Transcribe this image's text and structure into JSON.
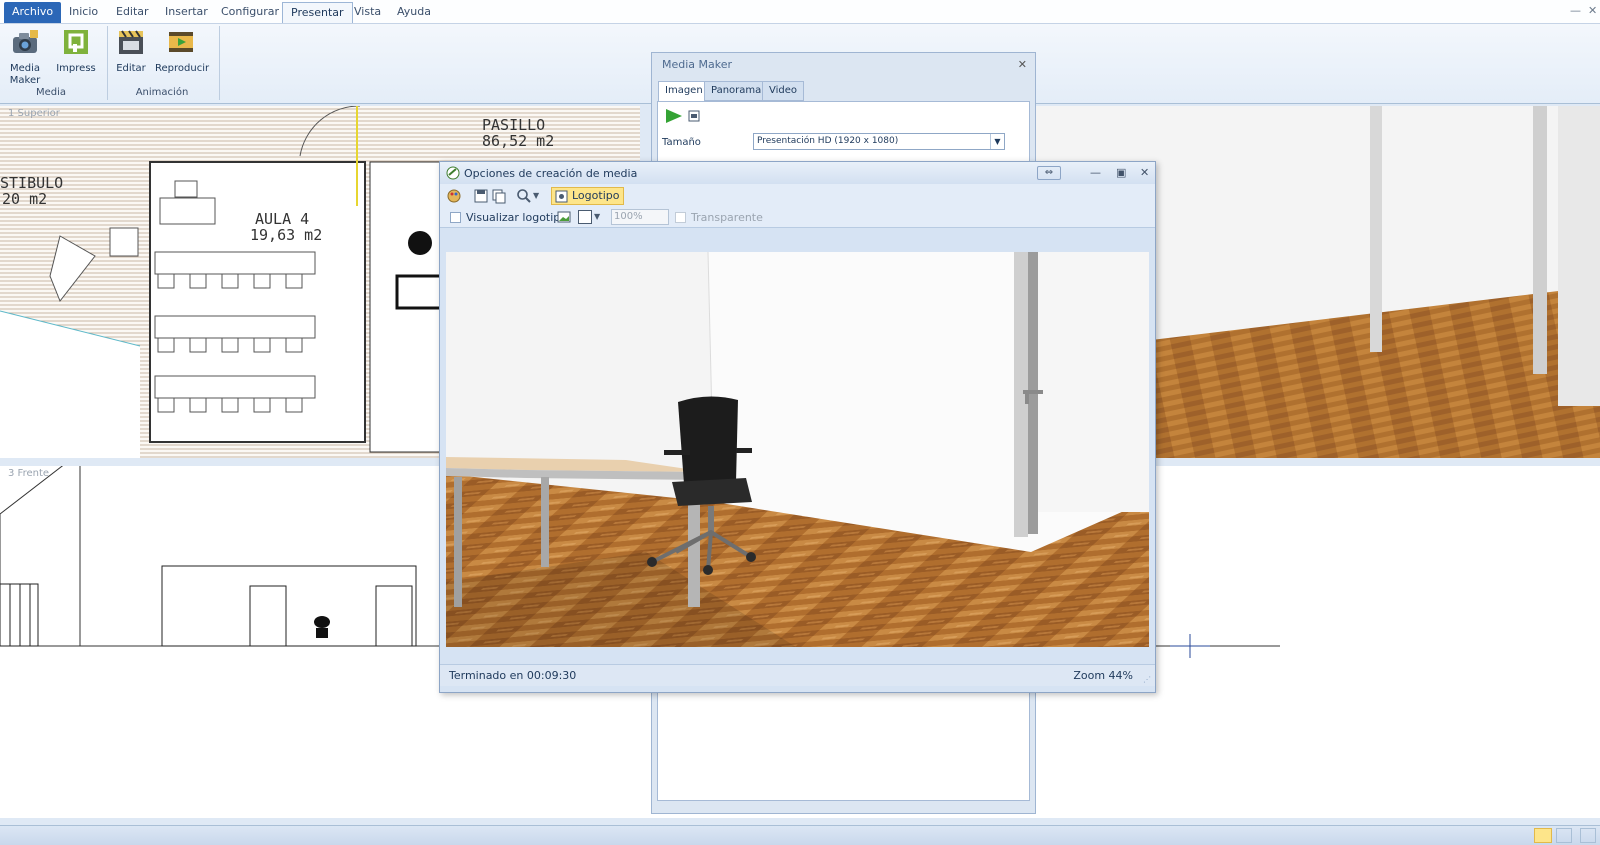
{
  "menu": {
    "tabs": [
      {
        "label": "Archivo"
      },
      {
        "label": "Inicio"
      },
      {
        "label": "Editar"
      },
      {
        "label": "Insertar"
      },
      {
        "label": "Configurar"
      },
      {
        "label": "Presentar"
      },
      {
        "label": "Vista"
      },
      {
        "label": "Ayuda"
      }
    ],
    "active": "Presentar"
  },
  "ribbon": {
    "buttons": {
      "media_maker": "Media\nMaker",
      "impress": "Impress",
      "editar": "Editar",
      "reproducir": "Reproducir"
    },
    "groups": {
      "media": "Media",
      "animacion": "Animación"
    }
  },
  "viewports": {
    "plan": {
      "label": "1 Superior",
      "rooms": [
        {
          "name": "PASILLO",
          "area": "86,52 m2"
        },
        {
          "name": "AULA 4",
          "area": "19,63 m2"
        },
        {
          "name": "STIBULO",
          "area": "20 m2"
        }
      ]
    },
    "front": {
      "label": "3 Frente"
    }
  },
  "media_maker": {
    "title": "Media Maker",
    "tabs": [
      "Imagen",
      "Panorama",
      "Video"
    ],
    "active_tab": "Imagen",
    "size_label": "Tamaño",
    "size_value": "Presentación HD (1920 x 1080)"
  },
  "dialog": {
    "title": "Opciones de creación de media",
    "logo_button": "Logotipo",
    "show_logo_label": "Visualizar logotipo",
    "show_logo_checked": false,
    "opacity_value": "100%",
    "transparent_label": "Transparente",
    "status": "Terminado en 00:09:30",
    "zoom": "Zoom 44%"
  },
  "colors": {
    "accent": "#2b67b7",
    "highlight": "#fde58a",
    "floor_wood": "#b8793a",
    "chair": "#1f1f1f"
  }
}
